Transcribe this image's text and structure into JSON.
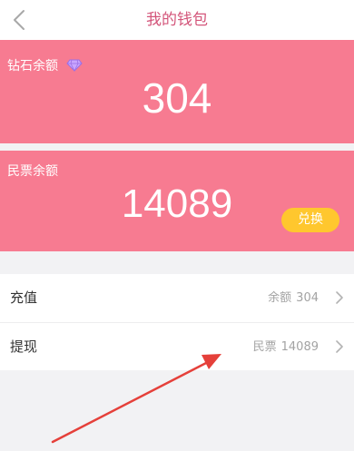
{
  "header": {
    "title": "我的钱包"
  },
  "diamond_card": {
    "label": "钻石余额",
    "value": "304",
    "icon": "diamond-icon"
  },
  "ticket_card": {
    "label": "民票余额",
    "value": "14089",
    "exchange_label": "兑换"
  },
  "list": {
    "recharge": {
      "label": "充值",
      "detail_prefix": "余额",
      "detail_value": "304"
    },
    "withdraw": {
      "label": "提现",
      "detail_prefix": "民票",
      "detail_value": "14089"
    }
  },
  "colors": {
    "card_pink": "#f77b91",
    "title_pink": "#d3557a",
    "exchange_yellow": "#ffc72e",
    "arrow_red": "#e5403a"
  }
}
